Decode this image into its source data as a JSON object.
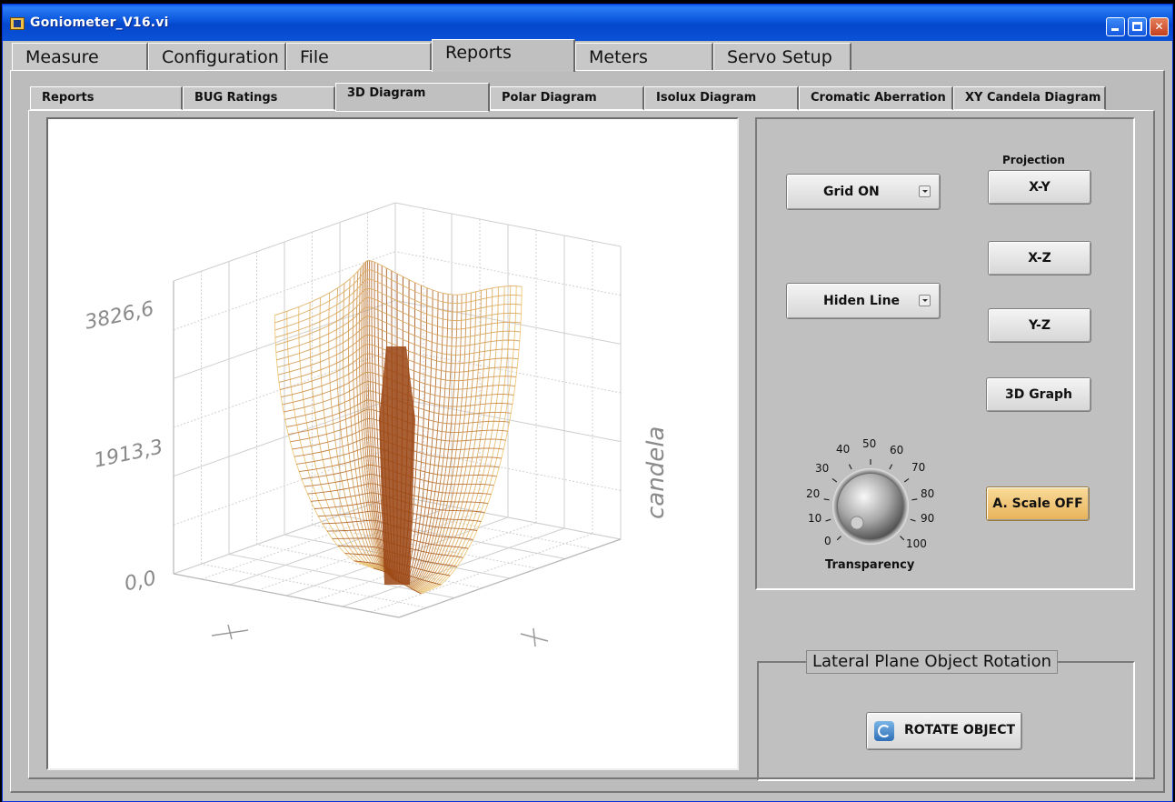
{
  "window": {
    "title": "Goniometer_V16.vi"
  },
  "main_tabs": [
    "Measure",
    "Configuration",
    "File",
    "Reports",
    "Meters",
    "Servo Setup"
  ],
  "sub_tabs": [
    "Reports",
    "BUG Ratings",
    "3D Diagram",
    "Polar Diagram",
    "Isolux Diagram",
    "Cromatic Aberration",
    "XY Candela Diagram"
  ],
  "graph": {
    "z_ticks": [
      "3826,6",
      "1913,3",
      "0,0"
    ],
    "z_axis_label": "candela",
    "x_axis_label": "x",
    "y_axis_label": "y"
  },
  "controls": {
    "grid_menu": "Grid ON",
    "line_menu": "Hiden Line",
    "projection_title": "Projection",
    "proj_xy": "X-Y",
    "proj_xz": "X-Z",
    "proj_yz": "Y-Z",
    "graph_3d": "3D Graph",
    "auto_scale": "A. Scale OFF",
    "knob_label": "Transparency",
    "knob_ticks": [
      "0",
      "10",
      "20",
      "30",
      "40",
      "50",
      "60",
      "70",
      "80",
      "90",
      "100"
    ]
  },
  "rotation": {
    "group_label": "Lateral Plane Object Rotation",
    "rotate_button": "ROTATE OBJECT"
  },
  "colors": {
    "surface_light": "#ffe08a",
    "surface_dark": "#8a3c10",
    "accent_button": "#e8b25a"
  }
}
